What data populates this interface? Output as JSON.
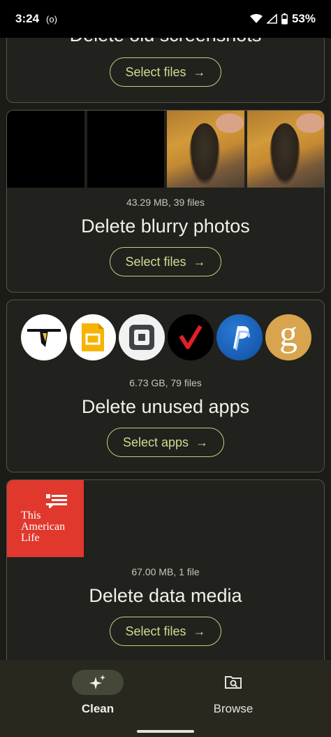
{
  "status": {
    "time": "3:24",
    "battery": "53%"
  },
  "cards": [
    {
      "title": "Delete old screenshots",
      "button": "Select files"
    },
    {
      "meta": "43.29 MB, 39 files",
      "title": "Delete blurry photos",
      "button": "Select files"
    },
    {
      "meta": "6.73 GB, 79 files",
      "title": "Delete unused apps",
      "button": "Select apps",
      "apps": [
        "bird-app-icon",
        "slides-app-icon",
        "square-app-icon",
        "verizon-app-icon",
        "paypal-app-icon",
        "goodreads-app-icon"
      ]
    },
    {
      "meta": "67.00 MB, 1 file",
      "title": "Delete data media",
      "button": "Select files",
      "logo_text": "This American Life"
    }
  ],
  "nav": {
    "clean": "Clean",
    "browse": "Browse"
  },
  "arrow": "→"
}
